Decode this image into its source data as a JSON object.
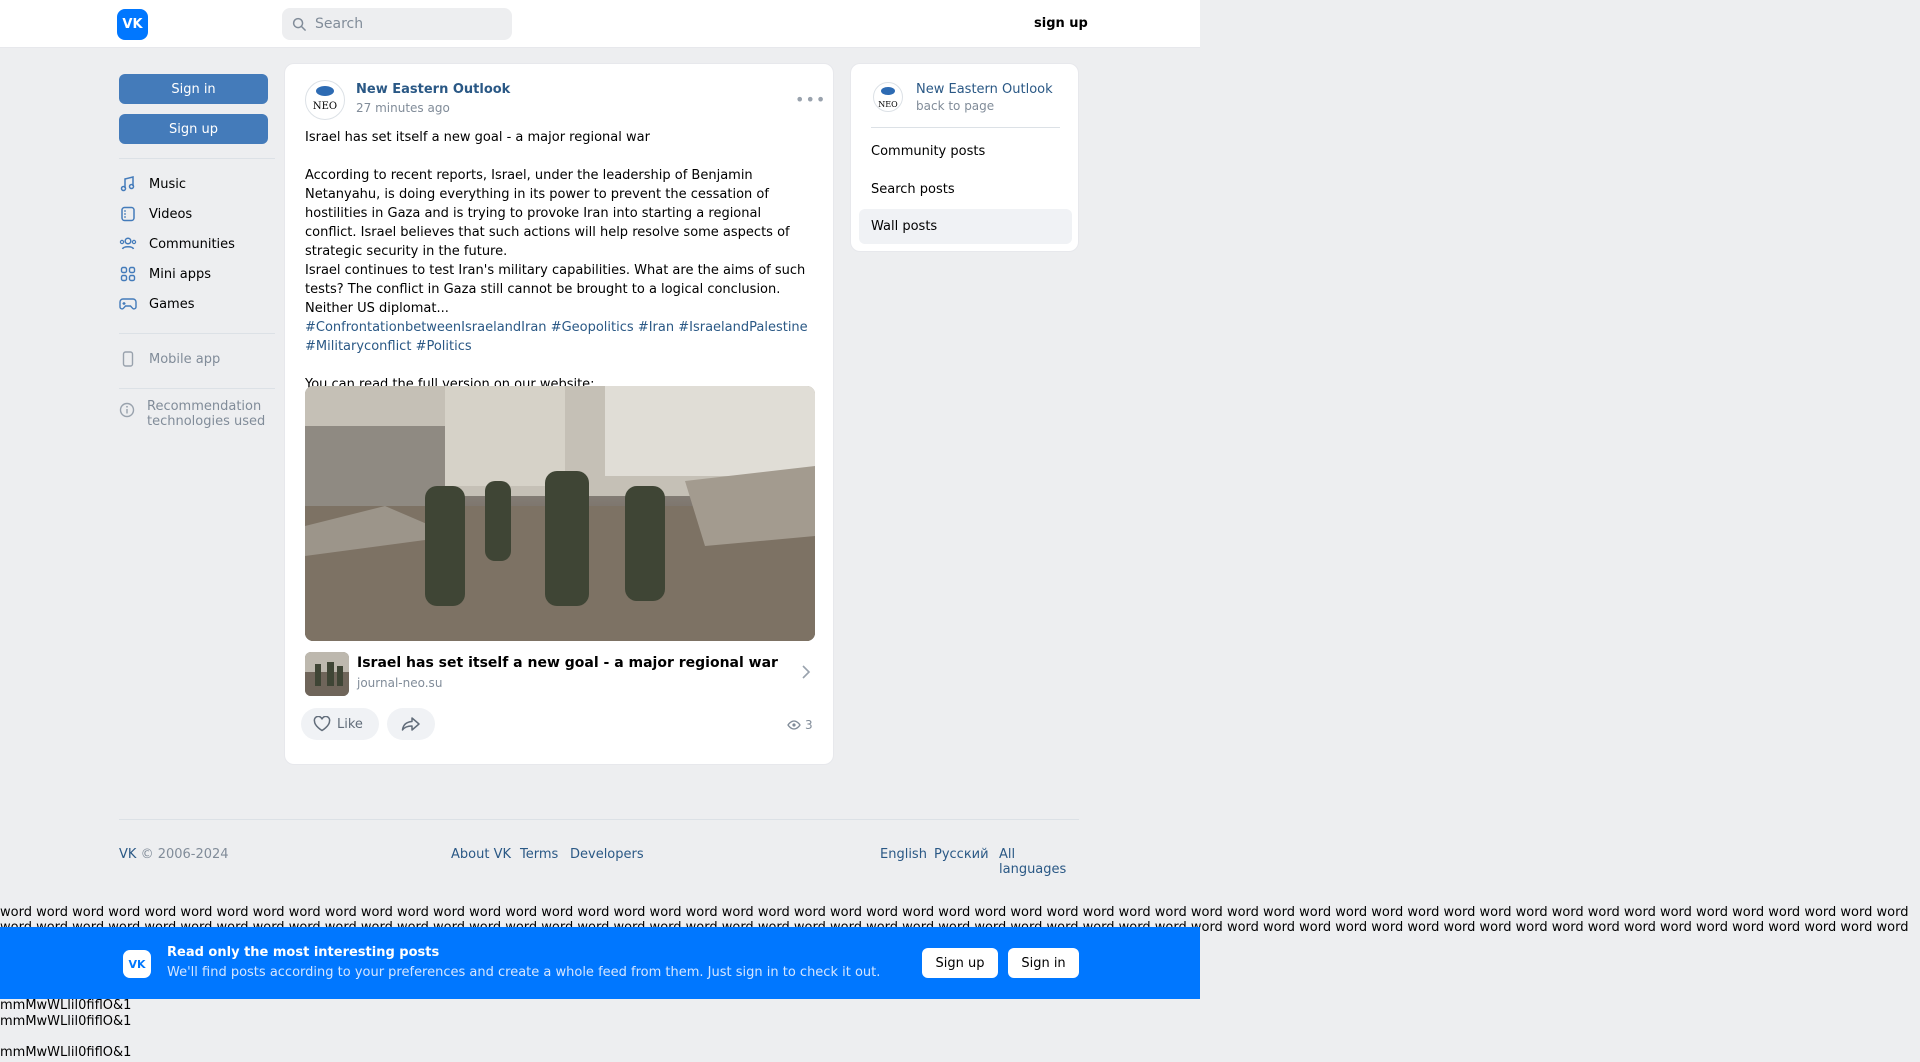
{
  "header": {
    "logo_text": "VK",
    "search_placeholder": "Search",
    "signup_label": "sign up"
  },
  "left": {
    "signin": "Sign in",
    "signup": "Sign up",
    "nav": [
      {
        "icon": "music-icon",
        "label": "Music"
      },
      {
        "icon": "videos-icon",
        "label": "Videos"
      },
      {
        "icon": "communities-icon",
        "label": "Communities"
      },
      {
        "icon": "mini-apps-icon",
        "label": "Mini apps"
      },
      {
        "icon": "games-icon",
        "label": "Games"
      }
    ],
    "mobile_app": "Mobile app",
    "recommendation": "Recommendation technologies used"
  },
  "post": {
    "author": "New Eastern Outlook",
    "avatar_text": "NEO",
    "time": "27 minutes ago",
    "title_line": "Israel has set itself a new goal - a major regional war",
    "body_1": "According to recent reports, Israel, under the leadership of Benjamin Netanyahu, is doing everything in its power to prevent the cessation of hostilities in Gaza and is trying to provoke Iran into starting a regional conflict. Israel believes that such actions will help resolve some aspects of strategic security in the future.",
    "body_2": "Israel continues to test Iran's military capabilities. What are the aims of such tests? The conflict in Gaza still cannot be brought to a logical conclusion. Neither US diplomat...",
    "hashtags": [
      "#ConfrontationbetweenIsraelandIran",
      "#Geopolitics",
      "#Iran",
      "#IsraelandPalestine",
      "#Militaryconflict",
      "#Politics"
    ],
    "website_note": "You can read the full version on our website:",
    "link_title": "Israel has set itself a new goal - a major regional war",
    "link_domain": "journal-neo.su",
    "like_label": "Like",
    "views": "3"
  },
  "right": {
    "name": "New Eastern Outlook",
    "back": "back to page",
    "items": [
      "Community posts",
      "Search posts",
      "Wall posts"
    ]
  },
  "footer": {
    "vk": "VK",
    "copyright": "© 2006-2024",
    "about": "About VK",
    "terms": "Terms",
    "developers": "Developers",
    "english": "English",
    "russian": "Русский",
    "all_languages": "All languages"
  },
  "words_line": "word word word word word word word word word word word word word word word word word word word word word word word word word word word word word word word word word word word word word word word word word word word word word word word word word word word word word word word word word word word word word word word word word word word word word word word word word word word word word word word word word word word word word word word word word word word word word word word word word word word word word word word word word word word word word word word word word word word word word word word word",
  "banner": {
    "title": "Read only the most interesting posts",
    "subtitle": "We'll find posts according to your preferences and create a whole feed from them. Just sign in to check it out.",
    "signup": "Sign up",
    "signin": "Sign in"
  },
  "garbage_lines": [
    "mmMwWLlil0fiflO&1",
    "mmMwWLlil0fiflO&1",
    "mmMwWLlil0fiflO&1"
  ],
  "colors": {
    "accent": "#0077ff",
    "link": "#2a5885",
    "button": "#447bba",
    "background": "#edeef0"
  }
}
